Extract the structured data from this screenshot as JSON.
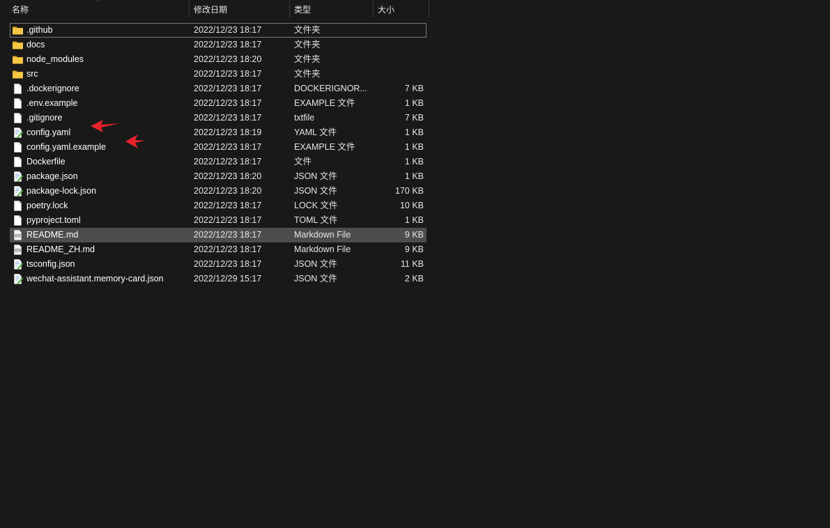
{
  "header": {
    "name": "名称",
    "date": "修改日期",
    "type": "类型",
    "size": "大小",
    "sort_indicator": "^"
  },
  "rows": [
    {
      "name": ".github",
      "date": "2022/12/23 18:17",
      "type": "文件夹",
      "size": "",
      "icon": "folder-icon",
      "state": "focused"
    },
    {
      "name": "docs",
      "date": "2022/12/23 18:17",
      "type": "文件夹",
      "size": "",
      "icon": "folder-icon",
      "state": ""
    },
    {
      "name": "node_modules",
      "date": "2022/12/23 18:20",
      "type": "文件夹",
      "size": "",
      "icon": "folder-icon",
      "state": ""
    },
    {
      "name": "src",
      "date": "2022/12/23 18:17",
      "type": "文件夹",
      "size": "",
      "icon": "folder-icon",
      "state": ""
    },
    {
      "name": ".dockerignore",
      "date": "2022/12/23 18:17",
      "type": "DOCKERIGNOR...",
      "size": "7 KB",
      "icon": "file-icon",
      "state": ""
    },
    {
      "name": ".env.example",
      "date": "2022/12/23 18:17",
      "type": "EXAMPLE 文件",
      "size": "1 KB",
      "icon": "file-icon",
      "state": ""
    },
    {
      "name": ".gitignore",
      "date": "2022/12/23 18:17",
      "type": "txtfile",
      "size": "7 KB",
      "icon": "file-icon",
      "state": ""
    },
    {
      "name": "config.yaml",
      "date": "2022/12/23 18:19",
      "type": "YAML 文件",
      "size": "1 KB",
      "icon": "edit-file-icon",
      "state": ""
    },
    {
      "name": "config.yaml.example",
      "date": "2022/12/23 18:17",
      "type": "EXAMPLE 文件",
      "size": "1 KB",
      "icon": "file-icon",
      "state": ""
    },
    {
      "name": "Dockerfile",
      "date": "2022/12/23 18:17",
      "type": "文件",
      "size": "1 KB",
      "icon": "file-icon",
      "state": ""
    },
    {
      "name": "package.json",
      "date": "2022/12/23 18:20",
      "type": "JSON 文件",
      "size": "1 KB",
      "icon": "edit-file-icon",
      "state": ""
    },
    {
      "name": "package-lock.json",
      "date": "2022/12/23 18:20",
      "type": "JSON 文件",
      "size": "170 KB",
      "icon": "edit-file-icon",
      "state": ""
    },
    {
      "name": "poetry.lock",
      "date": "2022/12/23 18:17",
      "type": "LOCK 文件",
      "size": "10 KB",
      "icon": "file-icon",
      "state": ""
    },
    {
      "name": "pyproject.toml",
      "date": "2022/12/23 18:17",
      "type": "TOML 文件",
      "size": "1 KB",
      "icon": "file-icon",
      "state": ""
    },
    {
      "name": "README.md",
      "date": "2022/12/23 18:17",
      "type": "Markdown File",
      "size": "9 KB",
      "icon": "markdown-file-icon",
      "state": "selected"
    },
    {
      "name": "README_ZH.md",
      "date": "2022/12/23 18:17",
      "type": "Markdown File",
      "size": "9 KB",
      "icon": "markdown-file-icon",
      "state": ""
    },
    {
      "name": "tsconfig.json",
      "date": "2022/12/23 18:17",
      "type": "JSON 文件",
      "size": "11 KB",
      "icon": "edit-file-icon",
      "state": ""
    },
    {
      "name": "wechat-assistant.memory-card.json",
      "date": "2022/12/29 15:17",
      "type": "JSON 文件",
      "size": "2 KB",
      "icon": "edit-file-icon",
      "state": ""
    }
  ],
  "colors": {
    "background": "#191919",
    "selected_row": "#4d4d4d",
    "folder": "#f6c845",
    "annotation_arrow": "#e8232a"
  }
}
